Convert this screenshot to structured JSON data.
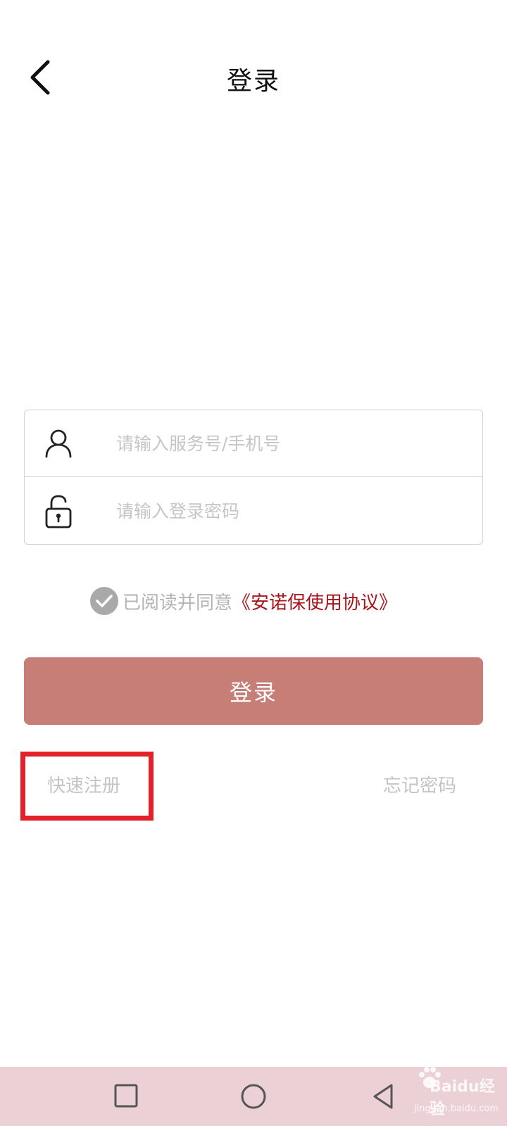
{
  "header": {
    "title": "登录",
    "back_icon": "chevron-left-icon"
  },
  "form": {
    "account_placeholder": "请输入服务号/手机号",
    "account_value": "",
    "account_icon": "user-icon",
    "password_placeholder": "请输入登录密码",
    "password_value": "",
    "password_icon": "lock-icon"
  },
  "agreement": {
    "checked": true,
    "text": "已阅读并同意",
    "link_text": "《安诺保使用协议》",
    "link_color": "#a8141c"
  },
  "login_button": {
    "label": "登录",
    "color": "#c67e77"
  },
  "links": {
    "quick_register": "快速注册",
    "forgot_password": "忘记密码",
    "highlight_color": "#e22128"
  },
  "nav_bar": {
    "background": "#ebd0d5",
    "icons": [
      "recent-apps-square-icon",
      "home-circle-icon",
      "back-triangle-icon"
    ]
  },
  "watermark": {
    "main": "Baidu经验",
    "sub": "jingyan.baidu.com"
  }
}
